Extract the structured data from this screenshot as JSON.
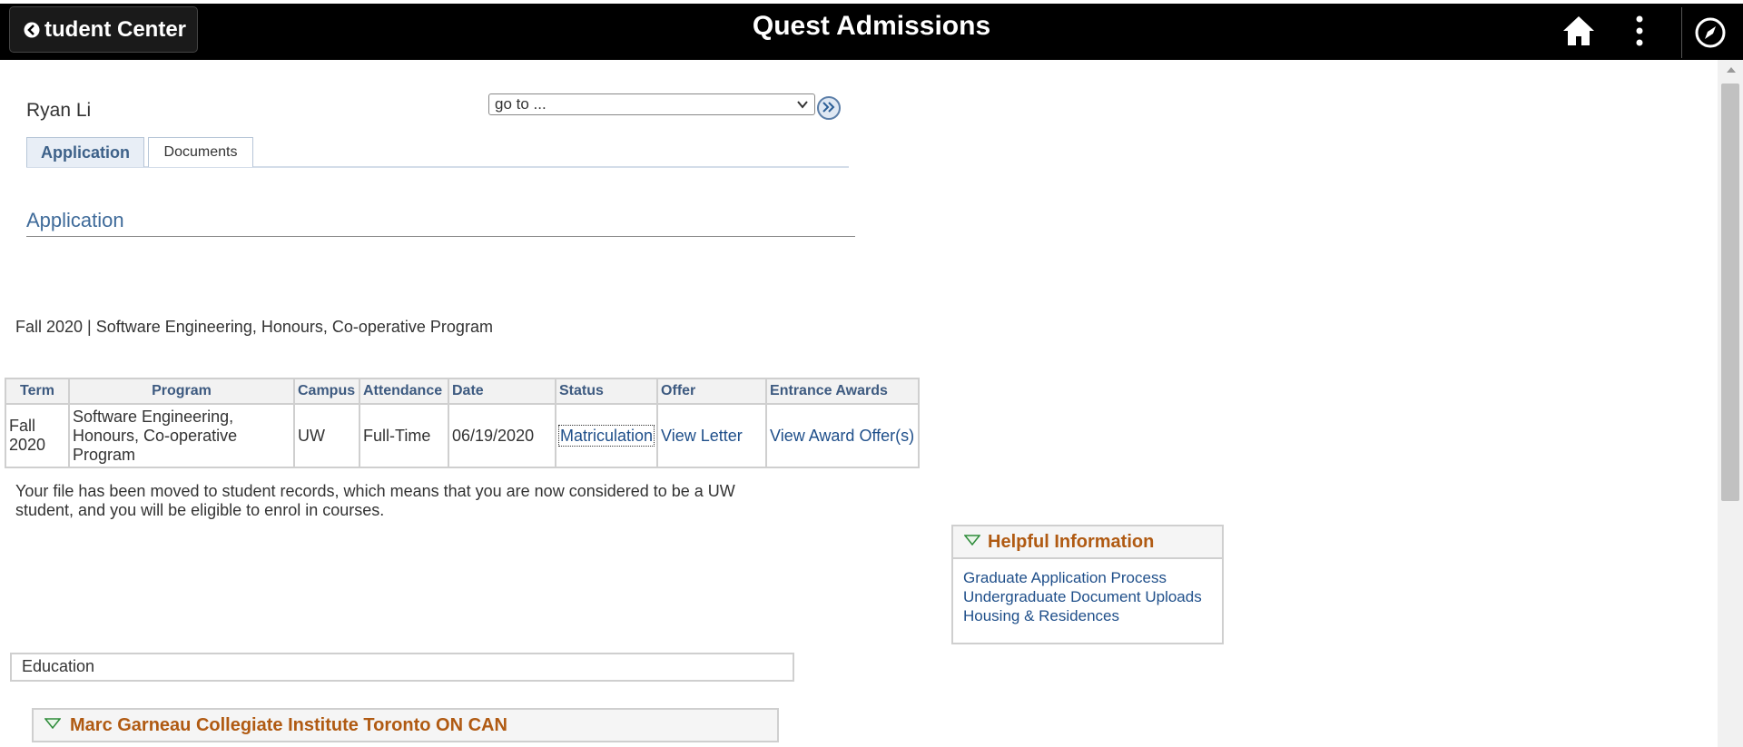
{
  "header": {
    "back_label": "tudent Center",
    "title": "Quest Admissions"
  },
  "user": {
    "name": "Ryan Li"
  },
  "goto": {
    "value": "go to ..."
  },
  "tabs": [
    {
      "label": "Application",
      "active": true
    },
    {
      "label": "Documents",
      "active": false
    }
  ],
  "section": {
    "title": "Application"
  },
  "program_line": "Fall 2020 | Software Engineering, Honours, Co-operative Program",
  "table": {
    "headers": [
      "Term",
      "Program",
      "Campus",
      "Attendance",
      "Date",
      "Status",
      "Offer",
      "Entrance Awards"
    ],
    "row": {
      "term": "Fall 2020",
      "program": "Software Engineering, Honours, Co-operative Program",
      "campus": "UW",
      "attendance": "Full-Time",
      "date": "06/19/2020",
      "status": "Matriculation",
      "offer": "View Letter",
      "awards": "View Award Offer(s)"
    }
  },
  "note": "Your file has been moved to student records, which means that you are now considered to be a UW student, and you will be eligible to enrol in courses.",
  "helpful": {
    "title": "Helpful Information",
    "links": [
      "Graduate Application Process",
      "Undergraduate Document Uploads",
      "Housing & Residences"
    ]
  },
  "education": {
    "label": "Education"
  },
  "school": {
    "title": "Marc Garneau Collegiate Institute Toronto ON CAN"
  },
  "colors": {
    "accent_orange": "#b05a12",
    "link_blue": "#1f4f8a",
    "header_bg": "#000000"
  }
}
